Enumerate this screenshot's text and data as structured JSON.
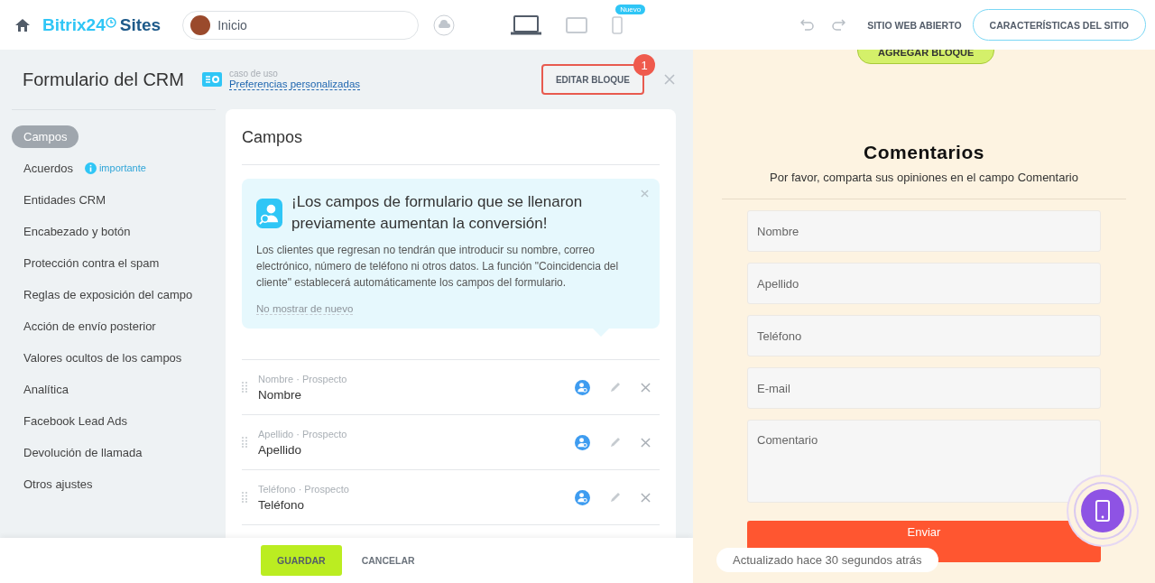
{
  "topbar": {
    "logo_main": "Bitrix24",
    "logo_sub": "Sites",
    "page_field": "Inicio",
    "devices": [
      {
        "kind": "laptop",
        "selected": true
      },
      {
        "kind": "tablet",
        "selected": false
      },
      {
        "kind": "phone",
        "selected": false,
        "badge": "Nuevo"
      }
    ],
    "open_site": "SITIO WEB ABIERTO",
    "site_settings": "CARACTERÍSTICAS DEL SITIO"
  },
  "panel": {
    "title": "Formulario del CRM",
    "use_case_label": "caso de uso",
    "use_case_link": "Preferencias personalizadas",
    "edit_button": "EDITAR BLOQUE",
    "edit_badge": "1"
  },
  "sidebar": {
    "items": [
      {
        "label": "Campos",
        "selected": true
      },
      {
        "label": "Acuerdos",
        "selected": false,
        "hint": "importante"
      },
      {
        "label": "Entidades CRM",
        "selected": false
      },
      {
        "label": "Encabezado y botón",
        "selected": false
      },
      {
        "label": "Protección contra el spam",
        "selected": false
      },
      {
        "label": "Reglas de exposición del campo",
        "selected": false
      },
      {
        "label": "Acción de envío posterior",
        "selected": false
      },
      {
        "label": "Valores ocultos de los campos",
        "selected": false
      },
      {
        "label": "Analítica",
        "selected": false
      },
      {
        "label": "Facebook Lead Ads",
        "selected": false
      },
      {
        "label": "Devolución de llamada",
        "selected": false
      },
      {
        "label": "Otros ajustes",
        "selected": false
      }
    ]
  },
  "fields_card": {
    "title": "Campos",
    "notice": {
      "title": "¡Los campos de formulario que se llenaron previamente aumentan la conversión!",
      "text": "Los clientes que regresan no tendrán que introducir su nombre, correo electrónico, número de teléfono ni otros datos. La función \"Coincidencia del cliente\" establecerá automáticamente los campos del formulario.",
      "dismiss": "No mostrar de nuevo"
    },
    "fields": [
      {
        "caption": "Nombre · Prospecto",
        "name": "Nombre"
      },
      {
        "caption": "Apellido · Prospecto",
        "name": "Apellido"
      },
      {
        "caption": "Teléfono · Prospecto",
        "name": "Teléfono"
      }
    ]
  },
  "footer": {
    "save": "GUARDAR",
    "cancel": "CANCELAR"
  },
  "preview": {
    "add_block": "AGREGAR BLOQUE",
    "title": "Comentarios",
    "subtitle": "Por favor, comparta sus opiniones en el campo Comentario",
    "inputs": [
      {
        "kind": "line",
        "placeholder": "Nombre"
      },
      {
        "kind": "line",
        "placeholder": "Apellido"
      },
      {
        "kind": "line",
        "placeholder": "Teléfono"
      },
      {
        "kind": "line",
        "placeholder": "E-mail"
      },
      {
        "kind": "area",
        "placeholder": "Comentario"
      }
    ],
    "submit": "Enviar",
    "status": "Actualizado hace 30 segundos atrás"
  }
}
